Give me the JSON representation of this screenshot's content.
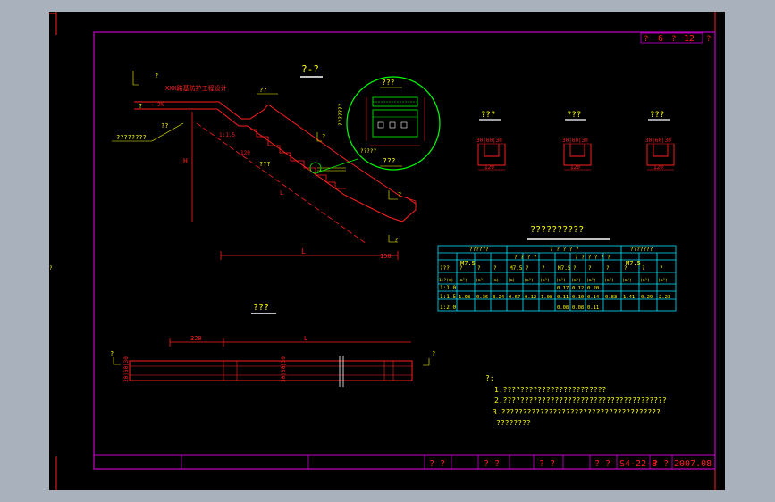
{
  "colors": {
    "background_outer": "#a9b1bc",
    "background_canvas": "#000000",
    "frame_magenta": "#c800c8",
    "red": "#ff2020",
    "yellow": "#ffff00",
    "green": "#00ff00",
    "cyan": "#00e5ff",
    "white": "#ffffff"
  },
  "header": {
    "sheet_label_a": "?",
    "sheet_no": "6",
    "sheet_label_b": "?",
    "sheet_total": "12",
    "sheet_label_c": "?"
  },
  "profile": {
    "title": "?-?",
    "top_note": "XXX路基防护工程设计",
    "label_1": "??",
    "label_2": "??",
    "label_3": "???",
    "label_4": "????????",
    "label_5": "???",
    "label_6": "?????",
    "label_7": "??",
    "slope_ratio_left": "1:1.5",
    "slope_len": "L",
    "dim_h": "H",
    "dim_l": "L",
    "dim_150": "150",
    "dim_120": "120",
    "dim_25": "← 2%",
    "mark_a": "?",
    "mark_b": "?",
    "mark_c": "?",
    "mark_d": "?",
    "mark_e": "?"
  },
  "detail": {
    "title_top": "???",
    "title_bottom": "???",
    "label_left": "???????",
    "dim_note": "?????"
  },
  "sections": [
    {
      "title": "???",
      "dim_top": "30|60|30",
      "dim_bottom": "120"
    },
    {
      "title": "???",
      "dim_top": "30|60|30",
      "dim_bottom": "120"
    },
    {
      "title": "???",
      "dim_top": "30|60|30",
      "dim_bottom": "120"
    }
  ],
  "plan": {
    "title": "???",
    "dim_320": "320",
    "dim_l": "L",
    "mark_left": "?",
    "mark_right": "?",
    "dim_v_left": "30|60|30",
    "dim_v_mid": "30|60|30"
  },
  "table": {
    "title": "??????????",
    "group_headers": [
      "??????",
      "? ? ? ? ?",
      "???????"
    ],
    "sub_headers": [
      "M7.5",
      "? ? ? ?",
      "? ? ? ? ? ?",
      "M7.5"
    ],
    "col_row1": [
      "???",
      "?",
      "?",
      "?",
      "M7.5",
      "?",
      "?",
      "M7.5",
      "?",
      "?",
      "?",
      "?",
      "?",
      "?",
      "?"
    ],
    "units": [
      "1:?(m)",
      "(m²)",
      "(m³)",
      "(m)",
      "(m)",
      "(m³)",
      "(m³)",
      "(m³)",
      "(m³)",
      "(m³)",
      "(m³)",
      "(m³)",
      "(m³)",
      "(m³)"
    ],
    "rows": [
      {
        "ratio": "1:1.0",
        "cells": [
          "",
          "",
          "",
          "",
          "",
          "",
          "0.17",
          "0.12",
          "0.20",
          "",
          "",
          "",
          ""
        ]
      },
      {
        "ratio": "1:1.5",
        "cells": [
          "1.98",
          "0.36",
          "3.24",
          "0.67",
          "0.12",
          "1.08",
          "0.11",
          "0.10",
          "0.14",
          "0.83",
          "1.41",
          "0.29",
          "2.23"
        ]
      },
      {
        "ratio": "1:2.0",
        "cells": [
          "",
          "",
          "",
          "",
          "",
          "",
          "0.08",
          "0.08",
          "0.11",
          "",
          "",
          "",
          ""
        ]
      }
    ]
  },
  "notes": {
    "heading": "?:",
    "lines": [
      "1.????????????????????????",
      "2.??????????????????????????????????????",
      "3.?????????????????????????????????????",
      "????????"
    ]
  },
  "title_block": {
    "cell_a": "? ?",
    "cell_b": "? ?",
    "cell_c": "? ?",
    "cell_d": "? ?",
    "drawing_no": "S4-22-8",
    "cell_e": "? ?",
    "date": "2007.08"
  }
}
